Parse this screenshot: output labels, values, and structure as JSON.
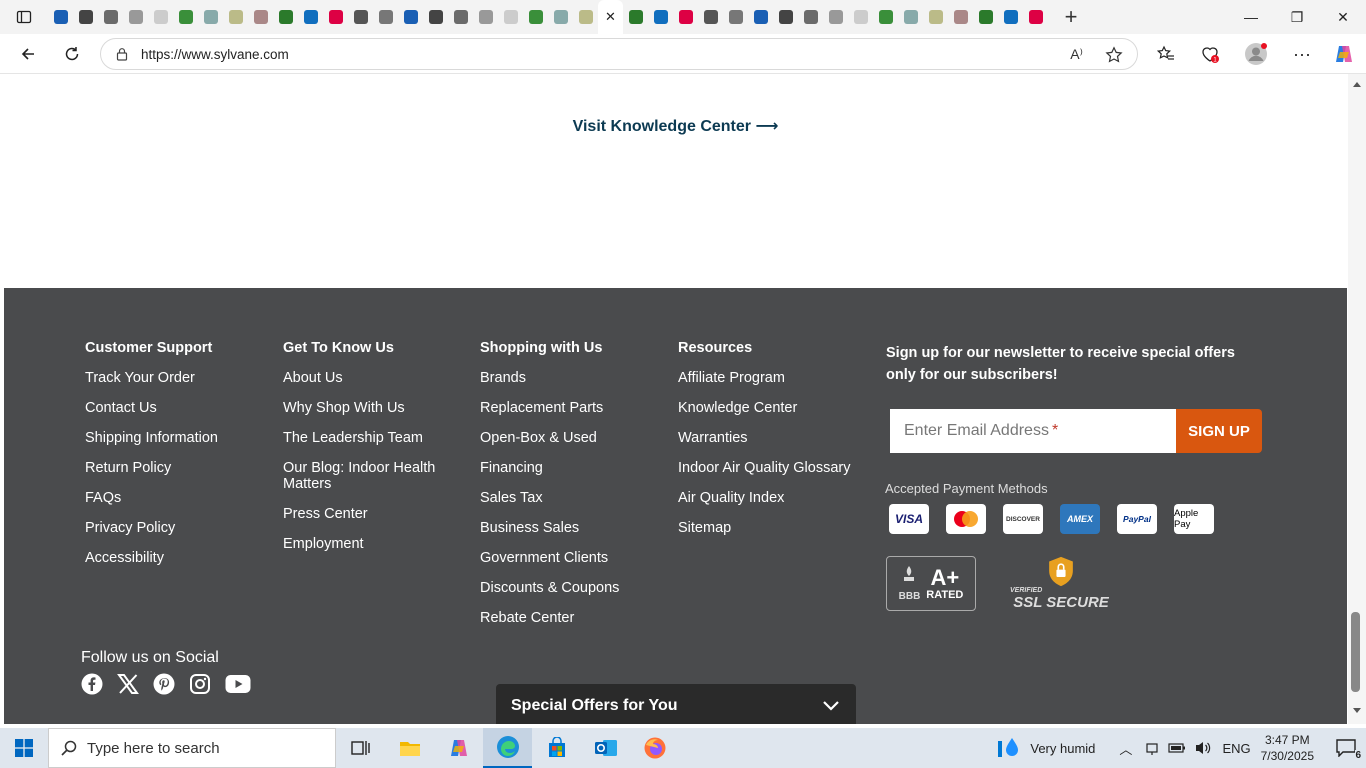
{
  "browser": {
    "url": "https://www.sylvane.com",
    "tab_count": 40,
    "colors": {
      "tabstrip": "#f3f3f3",
      "profile_alert": "#e81123"
    }
  },
  "page": {
    "knowledge_link": "Visit Knowledge Center ⟶"
  },
  "footer": {
    "bg_color": "#4a4b4d",
    "columns": [
      {
        "title": "Customer Support",
        "links": [
          "Track Your Order",
          "Contact Us",
          "Shipping Information",
          "Return Policy",
          "FAQs",
          "Privacy Policy",
          "Accessibility"
        ]
      },
      {
        "title": "Get To Know Us",
        "links": [
          "About Us",
          "Why Shop With Us",
          "The Leadership Team",
          "Our Blog: Indoor Health Matters",
          "Press Center",
          "Employment"
        ]
      },
      {
        "title": "Shopping with Us",
        "links": [
          "Brands",
          "Replacement Parts",
          "Open-Box & Used",
          "Financing",
          "Sales Tax",
          "Business Sales",
          "Government Clients",
          "Discounts & Coupons",
          "Rebate Center"
        ]
      },
      {
        "title": "Resources",
        "links": [
          "Affiliate Program",
          "Knowledge Center",
          "Warranties",
          "Indoor Air Quality Glossary",
          "Air Quality Index",
          "Sitemap"
        ]
      }
    ],
    "newsletter_text": "Sign up for our newsletter to receive special offers only for our subscribers!",
    "email_placeholder": "Enter Email Address",
    "email_required": "*",
    "signup_label": "SIGN UP",
    "signup_color": "#d9570f",
    "payment_title": "Accepted Payment Methods",
    "payment_methods": [
      "VISA",
      "Mastercard",
      "DISCOVER",
      "AMEX",
      "PayPal",
      "Apple Pay"
    ],
    "bbb_rating": "A+",
    "bbb_text": "RATED",
    "bbb_mark": "BBB",
    "ssl_verified": "VERIFIED",
    "ssl_text": "SSL SECURE",
    "social_title": "Follow us on Social",
    "social": [
      "facebook-icon",
      "x-icon",
      "pinterest-icon",
      "instagram-icon",
      "youtube-icon"
    ],
    "offers_label": "Special Offers for You"
  },
  "taskbar": {
    "search_placeholder": "Type here to search",
    "weather": "Very humid",
    "language": "ENG",
    "time": "3:47 PM",
    "date": "7/30/2025",
    "notifications": "6"
  }
}
